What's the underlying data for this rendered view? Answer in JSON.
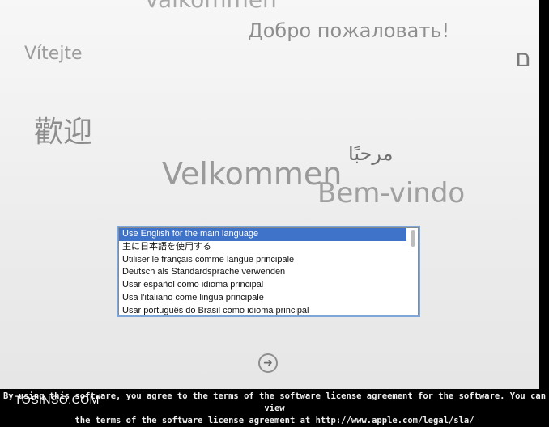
{
  "greetings": [
    "Välkommen",
    "Добро пожаловать!",
    "Vítejte",
    "ם",
    "歡迎",
    "مرحبًا",
    "Velkommen",
    "Bem-vindo"
  ],
  "language_list": {
    "items": [
      "Use English for the main language",
      "主に日本語を使用する",
      "Utiliser le français comme langue principale",
      "Deutsch als Standardsprache verwenden",
      "Usar español como idioma principal",
      "Usa l’italiano come lingua principale",
      "Usar português do Brasil como idioma principal"
    ]
  },
  "next_button": {
    "icon": "arrow-right-icon",
    "glyph": "➜"
  },
  "license_lines": [
    "By using this software, you agree to the terms of the software license agreement for the software. You can view",
    "the terms of the software license agreement at http://www.apple.com/legal/sla/"
  ],
  "watermark": "TOSINSO.COM"
}
